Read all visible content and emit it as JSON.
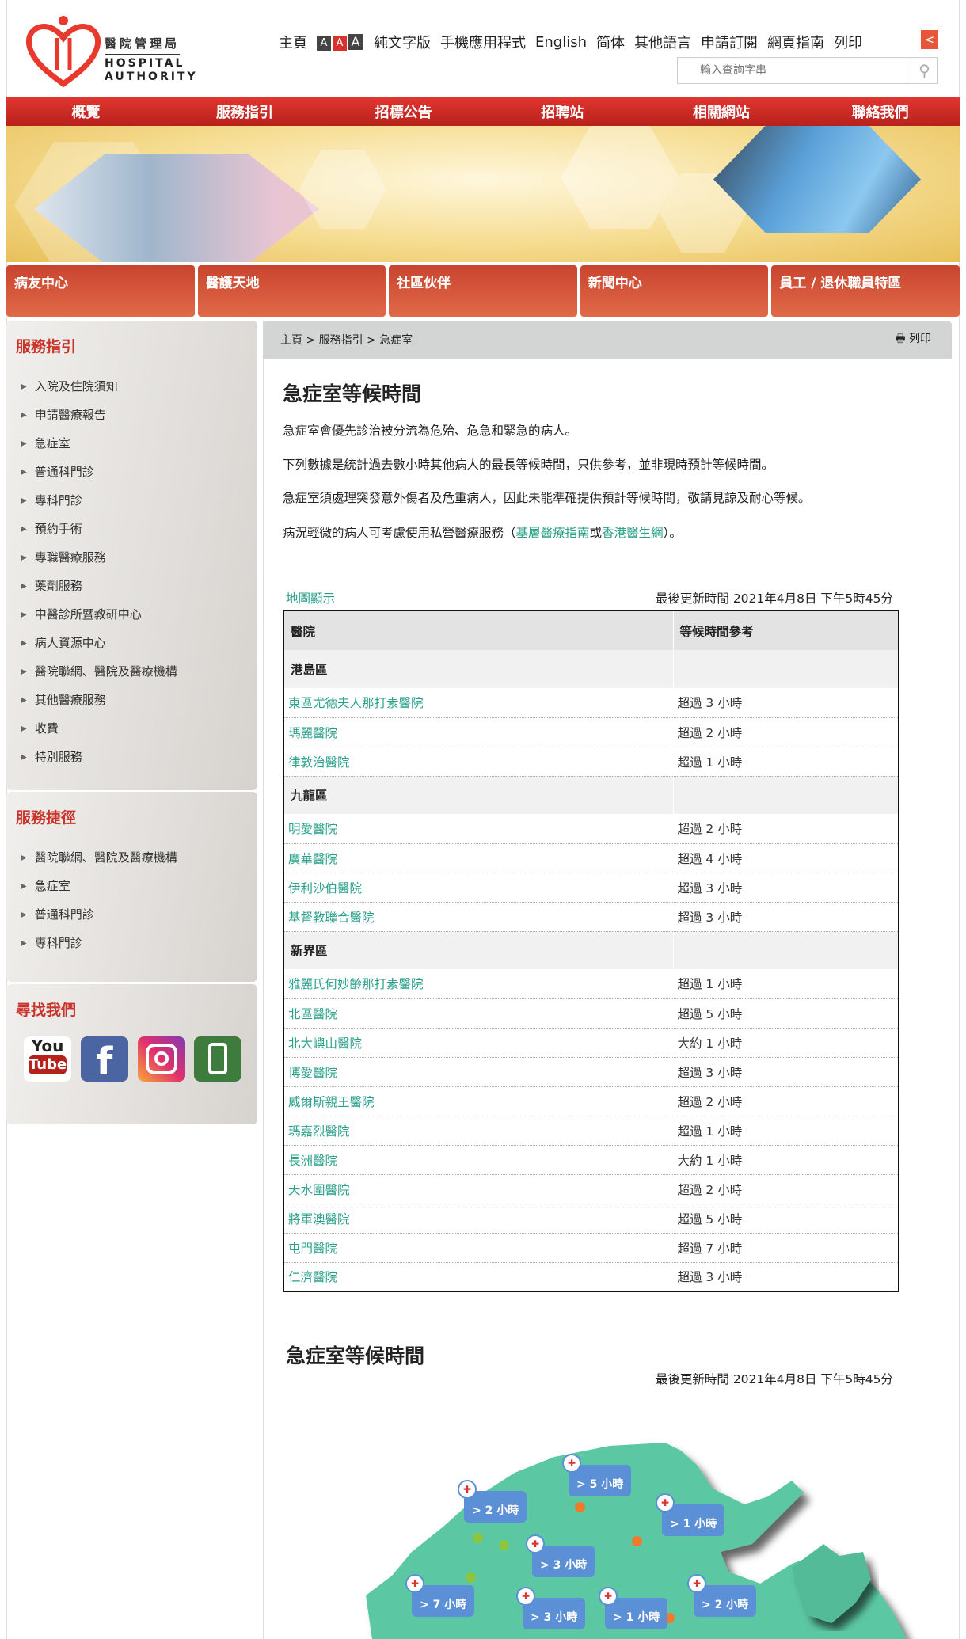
{
  "logo": {
    "zh": "醫院管理局",
    "en": "HOSPITAL AUTHORITY"
  },
  "toplinks": {
    "home": "主頁",
    "font_sizes": [
      "A",
      "A",
      "A"
    ],
    "text_only": "純文字版",
    "app": "手機應用程式",
    "english": "English",
    "simplified": "简体",
    "other_lang": "其他語言",
    "subscribe": "申請訂閱",
    "guide": "網頁指南",
    "print": "列印"
  },
  "search": {
    "placeholder": "輸入查詢字串"
  },
  "main_nav": [
    "概覽",
    "服務指引",
    "招標公告",
    "招聘站",
    "相關網站",
    "聯絡我們"
  ],
  "sub_nav": [
    "病友中心",
    "醫護天地",
    "社區伙伴",
    "新聞中心",
    "員工 / 退休職員特區"
  ],
  "sidebar": {
    "services_title": "服務指引",
    "services": [
      "入院及住院須知",
      "申請醫療報告",
      "急症室",
      "普通科門診",
      "專科門診",
      "預約手術",
      "專職醫療服務",
      "藥劑服務",
      "中醫診所暨教研中心",
      "病人資源中心",
      "醫院聯網、醫院及醫療機構",
      "其他醫療服務",
      "收費",
      "特別服務"
    ],
    "shortcuts_title": "服務捷徑",
    "shortcuts": [
      "醫院聯網、醫院及醫療機構",
      "急症室",
      "普通科門診",
      "專科門診"
    ],
    "find_us_title": "尋找我們",
    "social": {
      "youtube_top": "You",
      "youtube_bottom": "Tube",
      "facebook": "f"
    }
  },
  "breadcrumb": {
    "items": [
      "主頁",
      "服務指引",
      "急症室"
    ],
    "sep": ">",
    "print": "列印"
  },
  "page": {
    "title": "急症室等候時間",
    "p1": "急症室會優先診治被分流為危殆、危急和緊急的病人。",
    "p2": "下列數據是統計過去數小時其他病人的最長等候時間，只供參考，並非現時預計等候時間。",
    "p3": "急症室須處理突發意外傷者及危重病人，因此未能準確提供預計等候時間，敬請見諒及耐心等候。",
    "p4_pre": "病況輕微的病人可考慮使用私營醫療服務（",
    "p4_link1": "基層醫療指南",
    "p4_mid": "或",
    "p4_link2": "香港醫生網",
    "p4_post": "）。",
    "map_link": "地圖顯示",
    "updated": "最後更新時間 2021年4月8日 下午5時45分"
  },
  "table": {
    "headers": [
      "醫院",
      "等候時間參考"
    ],
    "regions": [
      {
        "name": "港島區",
        "rows": [
          [
            "東區尤德夫人那打素醫院",
            "超過 3 小時"
          ],
          [
            "瑪麗醫院",
            "超過 2 小時"
          ],
          [
            "律敦治醫院",
            "超過 1 小時"
          ]
        ]
      },
      {
        "name": "九龍區",
        "rows": [
          [
            "明愛醫院",
            "超過 2 小時"
          ],
          [
            "廣華醫院",
            "超過 4 小時"
          ],
          [
            "伊利沙伯醫院",
            "超過 3 小時"
          ],
          [
            "基督教聯合醫院",
            "超過 3 小時"
          ]
        ]
      },
      {
        "name": "新界區",
        "rows": [
          [
            "雅麗氏何妙齡那打素醫院",
            "超過 1 小時"
          ],
          [
            "北區醫院",
            "超過 5 小時"
          ],
          [
            "北大嶼山醫院",
            "大約 1 小時"
          ],
          [
            "博愛醫院",
            "超過 3 小時"
          ],
          [
            "威爾斯親王醫院",
            "超過 2 小時"
          ],
          [
            "瑪嘉烈醫院",
            "超過 1 小時"
          ],
          [
            "長洲醫院",
            "大約 1 小時"
          ],
          [
            "天水圍醫院",
            "超過 2 小時"
          ],
          [
            "將軍澳醫院",
            "超過 5 小時"
          ],
          [
            "屯門醫院",
            "超過 7 小時"
          ],
          [
            "仁濟醫院",
            "超過 3 小時"
          ]
        ]
      }
    ]
  },
  "map": {
    "title": "急症室等候時間",
    "updated": "最後更新時間 2021年4月8日 下午5時45分",
    "markers": [
      "> 5 小時",
      "> 2 小時",
      "> 1 小時",
      "> 3 小時",
      "> 7 小時",
      "> 3 小時",
      "> 1 小時",
      "> 2 小時"
    ],
    "colors": {
      "land": "#5cc7a3",
      "bubble": "#5b8fd6",
      "orange": "#f07a2a",
      "green": "#8cc63f",
      "yellow": "#f5c531"
    }
  }
}
